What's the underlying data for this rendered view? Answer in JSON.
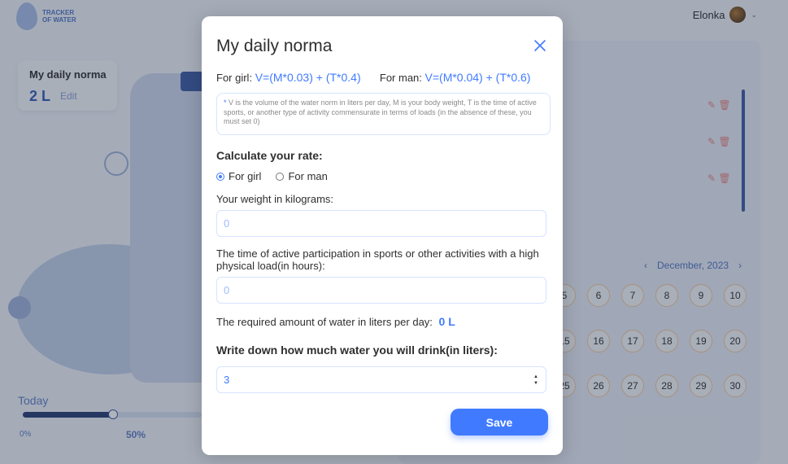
{
  "app": {
    "logo_text": "TRACKER\nOF WATER",
    "user_name": "Elonka"
  },
  "norma_card": {
    "title": "My daily norma",
    "value": "2 L",
    "edit": "Edit"
  },
  "today": {
    "label": "Today",
    "tick_0": "0%",
    "tick_50": "50%",
    "progress": 0.5
  },
  "calendar": {
    "month": "December, 2023",
    "days": [
      "5",
      "6",
      "7",
      "8",
      "9",
      "10",
      "15",
      "16",
      "17",
      "18",
      "19",
      "20",
      "25",
      "26",
      "27",
      "28",
      "29",
      "30"
    ]
  },
  "modal": {
    "title": "My daily norma",
    "girl_prefix": "For girl:",
    "girl_formula": "V=(M*0.03) + (T*0.4)",
    "man_prefix": "For man:",
    "man_formula": "V=(M*0.04) + (T*0.6)",
    "note_star": "*",
    "note_text": "V is the volume of the water norm in liters per day, M is your body weight, T is the time of active sports, or another type of activity commensurate in terms of loads (in the absence of these, you must set 0)",
    "calc_title": "Calculate your rate:",
    "radio_girl": "For girl",
    "radio_man": "For man",
    "selected_gender": "girl",
    "weight_label": "Your weight in kilograms:",
    "weight_value": "0",
    "time_label": "The time of active participation in sports or other activities with a high physical load(in hours):",
    "time_value": "0",
    "required_label": "The required amount of water in liters per day:",
    "required_amount": "0 L",
    "write_title": "Write down how much water you will drink(in liters):",
    "drink_value": "3",
    "save_label": "Save"
  },
  "colors": {
    "accent": "#407bff",
    "border": "#d7e3ff"
  }
}
